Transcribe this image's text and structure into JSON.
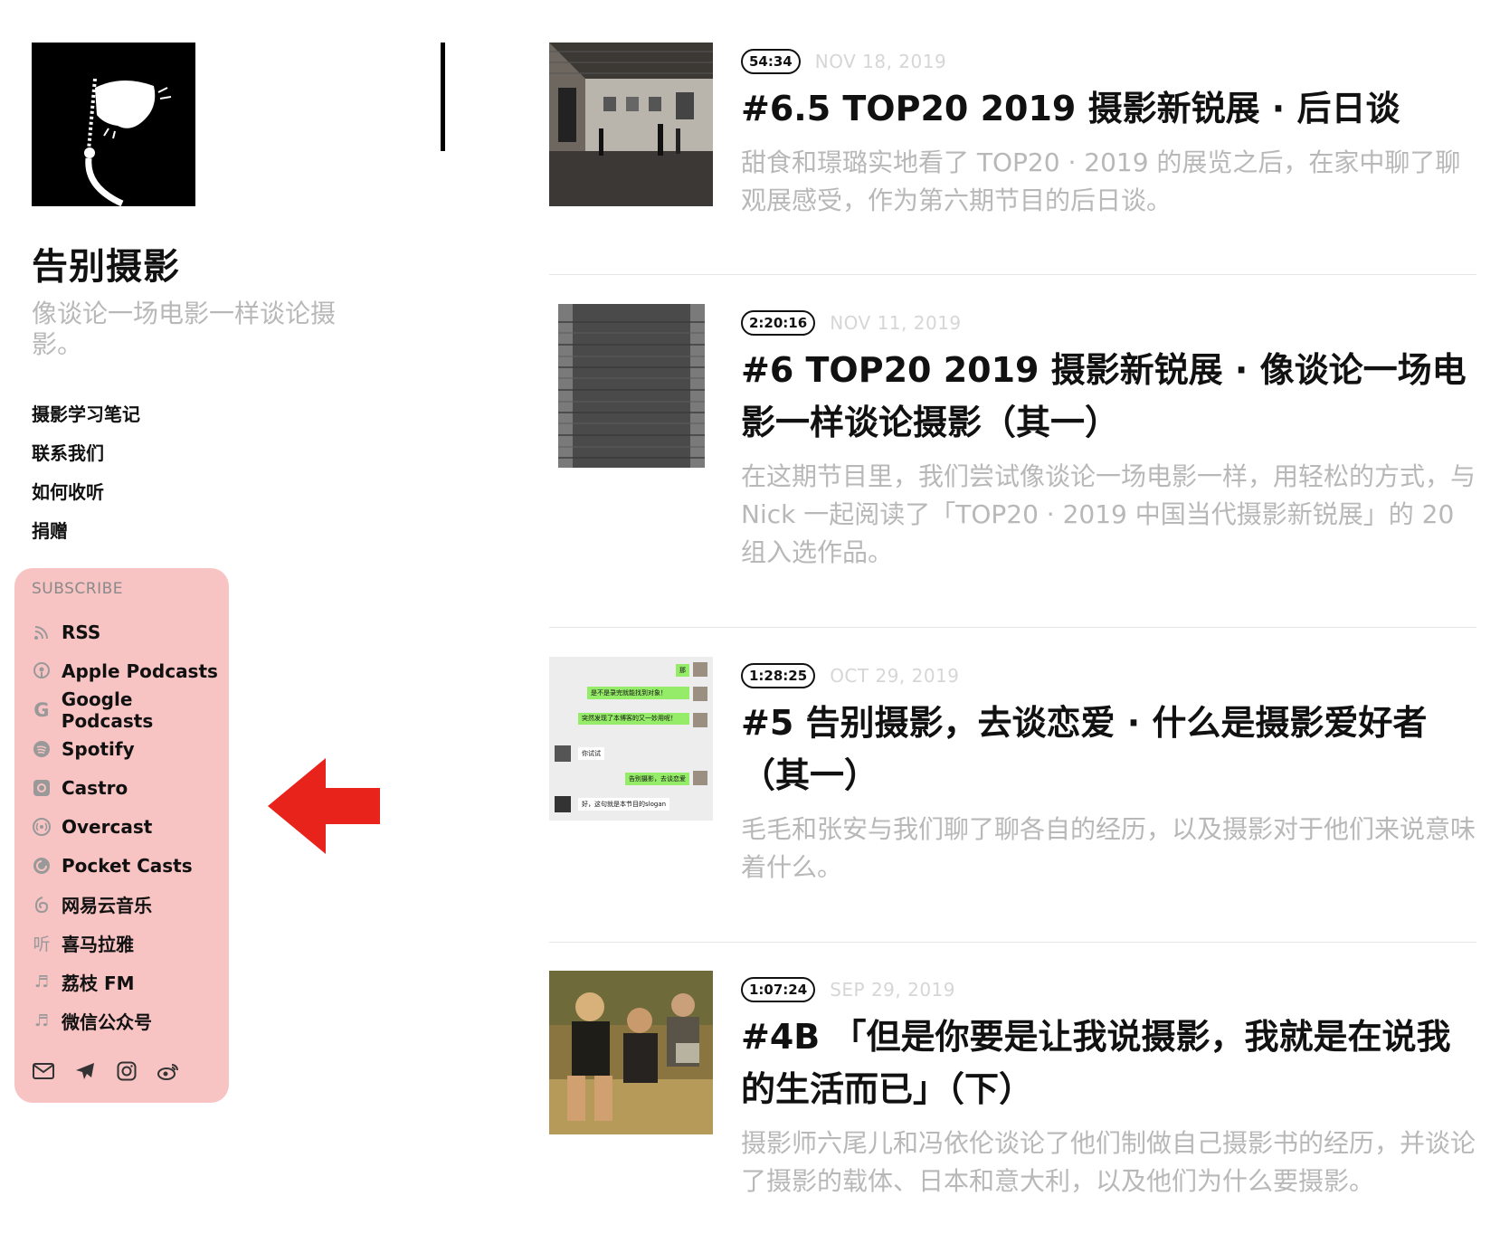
{
  "site": {
    "title": "告别摄影",
    "description": "像谈论一场电影一样谈论摄影。"
  },
  "nav": {
    "items": [
      "摄影学习笔记",
      "联系我们",
      "如何收听",
      "捐赠"
    ]
  },
  "subscribe": {
    "heading": "SUBSCRIBE",
    "background": "#f7c3c3",
    "items": [
      {
        "label": "RSS",
        "icon": "rss-icon"
      },
      {
        "label": "Apple Podcasts",
        "icon": "apple-podcasts-icon"
      },
      {
        "label": "Google Podcasts",
        "icon": "google-icon"
      },
      {
        "label": "Spotify",
        "icon": "spotify-icon"
      },
      {
        "label": "Castro",
        "icon": "castro-icon"
      },
      {
        "label": "Overcast",
        "icon": "overcast-icon"
      },
      {
        "label": "Pocket Casts",
        "icon": "pocket-casts-icon"
      },
      {
        "label": "网易云音乐",
        "icon": "netease-music-icon"
      },
      {
        "label": "喜马拉雅",
        "icon": "ximalaya-icon"
      },
      {
        "label": "荔枝 FM",
        "icon": "music-note-icon"
      },
      {
        "label": "微信公众号",
        "icon": "music-note-icon"
      }
    ],
    "social_icons": [
      "mail-icon",
      "telegram-icon",
      "instagram-icon",
      "weibo-icon"
    ]
  },
  "annotation": {
    "arrow_color": "#e8231c",
    "icon": "left-arrow-icon"
  },
  "episodes": [
    {
      "duration": "54:34",
      "date": "NOV 18, 2019",
      "title": "#6.5 TOP20 2019 摄影新锐展 · 后日谈",
      "description": "甜食和璟璐实地看了 TOP20 · 2019 的展览之后，在家中聊了聊观展感受，作为第六期节目的后日谈。",
      "thumb": "gallery-photo"
    },
    {
      "duration": "2:20:16",
      "date": "NOV 11, 2019",
      "title": "#6 TOP20 2019 摄影新锐展 · 像谈论一场电影一样谈论摄影（其一）",
      "description": "在这期节目里，我们尝试像谈论一场电影一样，用轻松的方式，与 Nick 一起阅读了「TOP20 · 2019 中国当代摄影新锐展」的 20 组入选作品。",
      "thumb": "dark-texture"
    },
    {
      "duration": "1:28:25",
      "date": "OCT 29, 2019",
      "title": "#5 告别摄影，去谈恋爱 · 什么是摄影爱好者（其一）",
      "description": "毛毛和张安与我们聊了聊各自的经历，以及摄影对于他们来说意味着什么。",
      "thumb": "chat-screenshot",
      "chat": [
        "那",
        "是不是录完就能找到对象！",
        "突然发现了本博客的又一妙用呢！",
        "你试试",
        "告别摄影，去谈恋爱",
        "好，这句就是本节目的slogan"
      ]
    },
    {
      "duration": "1:07:24",
      "date": "SEP 29, 2019",
      "title": "#4B 「但是你要是让我说摄影，我就是在说我的生活而已」（下）",
      "description": "摄影师六尾儿和冯依伦谈论了他们制做自己摄影书的经历，并谈论了摄影的载体、日本和意大利，以及他们为什么要摄影。",
      "thumb": "group-photo"
    }
  ]
}
